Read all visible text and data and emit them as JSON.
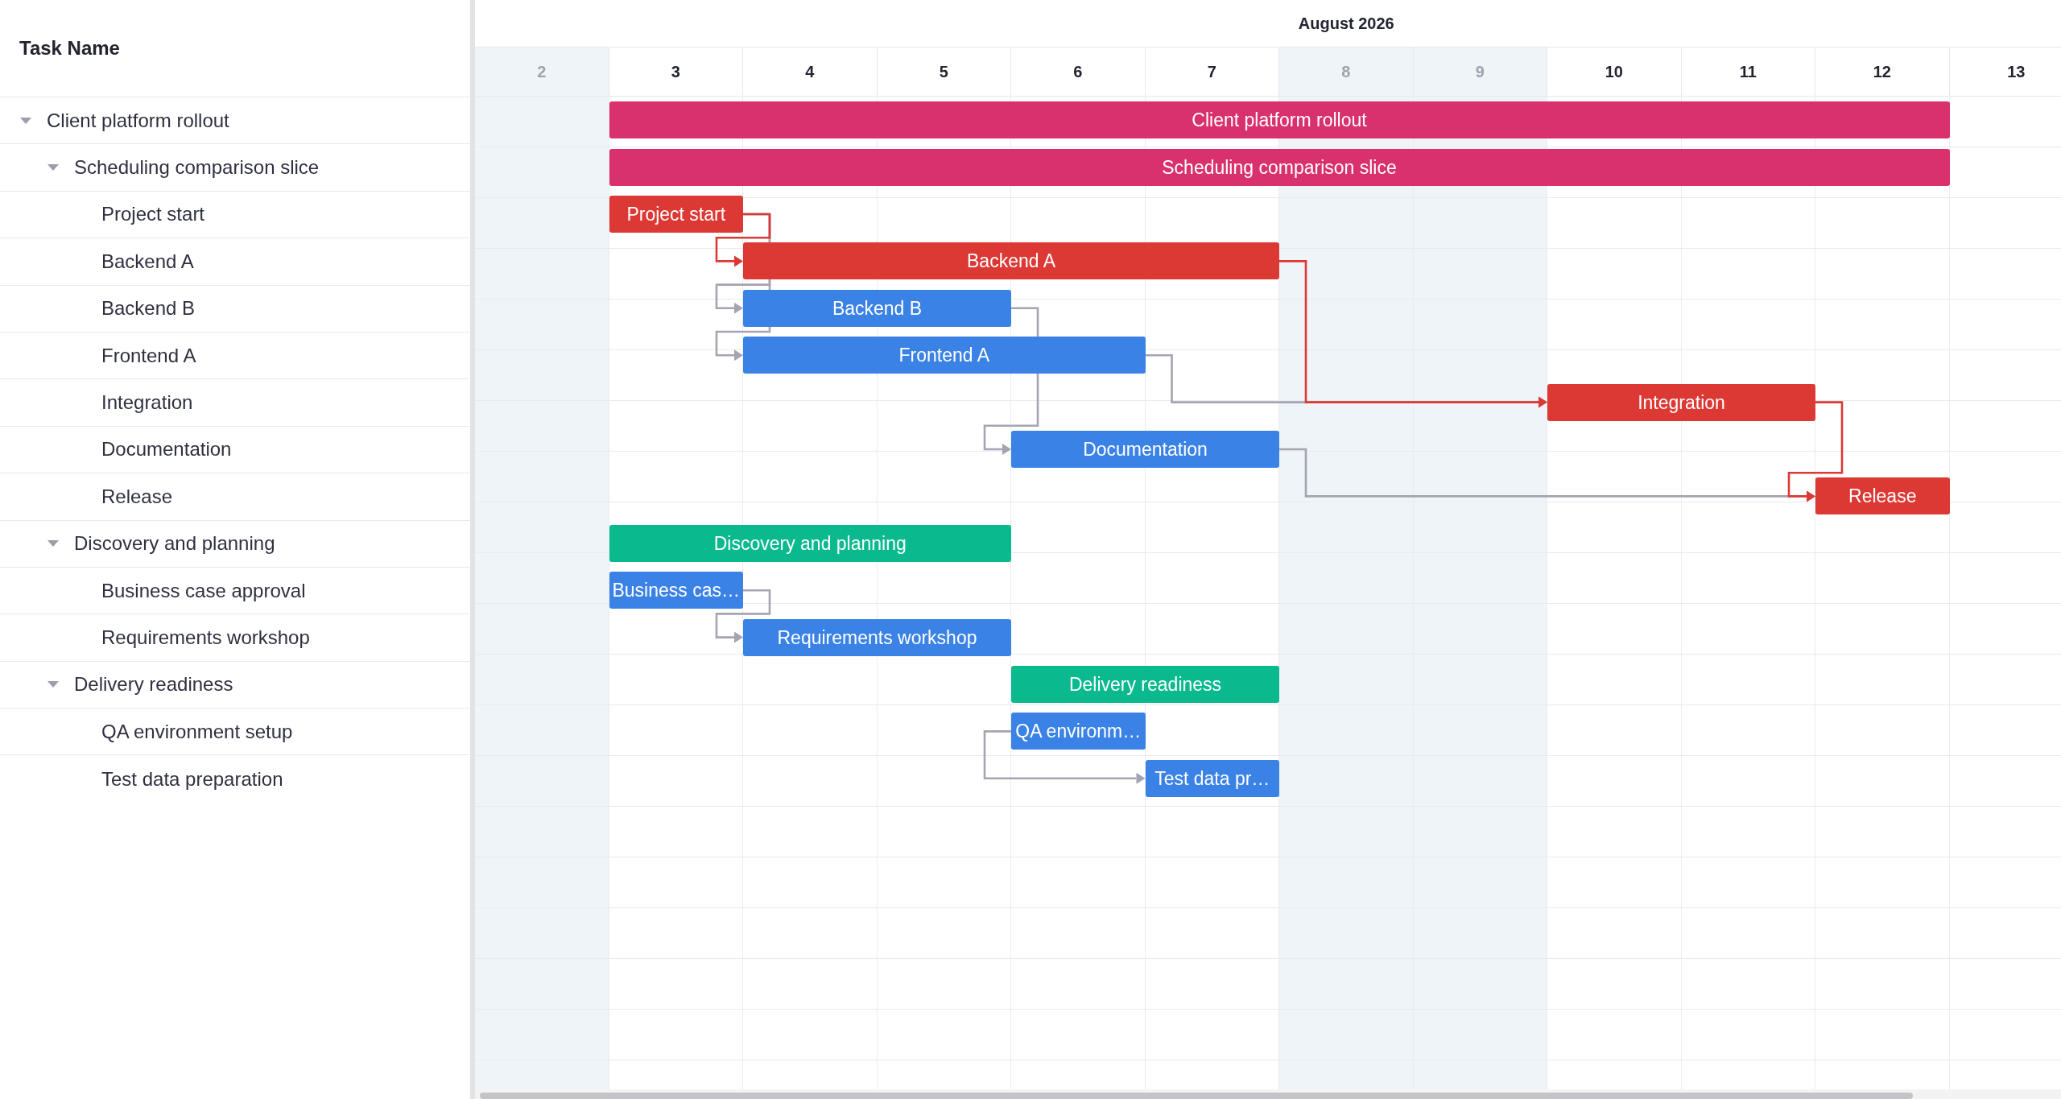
{
  "task_grid": {
    "header": "Task Name"
  },
  "timeline": {
    "month": "August 2026",
    "days": [
      {
        "label": "2",
        "weekend": true
      },
      {
        "label": "3",
        "weekend": false
      },
      {
        "label": "4",
        "weekend": false
      },
      {
        "label": "5",
        "weekend": false
      },
      {
        "label": "6",
        "weekend": false
      },
      {
        "label": "7",
        "weekend": false
      },
      {
        "label": "8",
        "weekend": true
      },
      {
        "label": "9",
        "weekend": true
      },
      {
        "label": "10",
        "weekend": false
      },
      {
        "label": "11",
        "weekend": false
      },
      {
        "label": "12",
        "weekend": false
      },
      {
        "label": "13",
        "weekend": false
      }
    ]
  },
  "tasks": [
    {
      "name": "Client platform rollout",
      "bar_label": "Client platform rollout",
      "color": "#d9306e",
      "critical": false,
      "expanded": true,
      "children": [
        {
          "name": "Scheduling comparison slice",
          "bar_label": "Scheduling comparison slice",
          "color": "#d9306e",
          "critical": false,
          "expanded": true,
          "children": [
            {
              "name": "Project start",
              "bar_label": "Project start",
              "critical": true
            },
            {
              "name": "Backend A",
              "bar_label": "Backend A",
              "critical": true
            },
            {
              "name": "Backend B",
              "bar_label": "Backend B",
              "color": "#3b82e6",
              "critical": false
            },
            {
              "name": "Frontend A",
              "bar_label": "Frontend A",
              "color": "#3b82e6",
              "critical": false
            },
            {
              "name": "Integration",
              "bar_label": "Integration",
              "critical": true
            },
            {
              "name": "Documentation",
              "bar_label": "Documentation",
              "color": "#3b82e6",
              "critical": false
            },
            {
              "name": "Release",
              "bar_label": "Release",
              "critical": true
            }
          ]
        },
        {
          "name": "Discovery and planning",
          "bar_label": "Discovery and planning",
          "color": "#0bb98f",
          "critical": false,
          "expanded": true,
          "children": [
            {
              "name": "Business case approval",
              "bar_label": "Business cas…",
              "color": "#3b82e6",
              "critical": false
            },
            {
              "name": "Requirements workshop",
              "bar_label": "Requirements workshop",
              "color": "#3b82e6",
              "critical": false
            }
          ]
        },
        {
          "name": "Delivery readiness",
          "bar_label": "Delivery readiness",
          "color": "#0bb98f",
          "critical": false,
          "expanded": true,
          "children": [
            {
              "name": "QA environment setup",
              "bar_label": "QA environm…",
              "color": "#3b82e6",
              "critical": false
            },
            {
              "name": "Test data preparation",
              "bar_label": "Test data pr…",
              "color": "#3b82e6",
              "critical": false
            }
          ]
        }
      ]
    }
  ]
}
